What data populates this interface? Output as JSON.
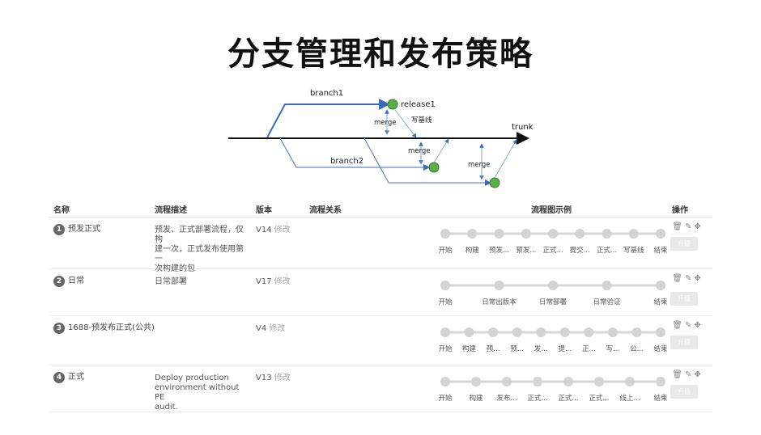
{
  "title": "分支管理和发布策略",
  "diagram": {
    "branch1": "branch1",
    "release1": "release1",
    "merge1": "merge",
    "baseline": "写基线",
    "trunk": "trunk",
    "merge2": "merge",
    "branch2": "branch2",
    "merge3": "merge"
  },
  "table": {
    "headers": {
      "name": "名称",
      "desc": "流程描述",
      "version": "版本",
      "relation": "流程关系",
      "flow": "流程图示例",
      "ops": "操作"
    },
    "edit_label": "修改",
    "upgrade_label": "升级",
    "rows": [
      {
        "num": "1",
        "name": "预发正式",
        "desc_lines": [
          "预发、正式部署流程，仅构",
          "建一次，正式发布使用第一",
          "次构建的包"
        ],
        "version": "V14",
        "steps": [
          "开始",
          "构建",
          "预发...",
          "预发...",
          "正式...",
          "提交...",
          "正式...",
          "写基线",
          "结束"
        ]
      },
      {
        "num": "2",
        "name": "日常",
        "desc_lines": [
          "日常部署"
        ],
        "version": "V17",
        "steps": [
          "开始",
          "日常出版本",
          "日常部署",
          "日常验证",
          "结束"
        ]
      },
      {
        "num": "3",
        "name": "1688-预发布正式(公共)",
        "desc_lines": [],
        "version": "V4",
        "steps": [
          "开始",
          "构建",
          "预...",
          "预...",
          "发...",
          "提...",
          "正...",
          "写...",
          "公...",
          "结束"
        ]
      },
      {
        "num": "4",
        "name": "正式",
        "desc_lines": [
          "Deploy production",
          "environment without PE",
          "audit."
        ],
        "version": "V13",
        "steps": [
          "开始",
          "构建",
          "发布...",
          "正式...",
          "正式...",
          "正式...",
          "线上...",
          "结束"
        ]
      }
    ]
  }
}
